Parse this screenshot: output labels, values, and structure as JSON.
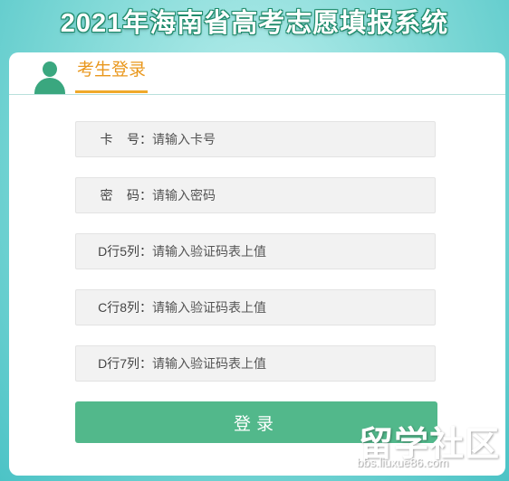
{
  "header": {
    "title": "2021年海南省高考志愿填报系统"
  },
  "login_tab": {
    "label": "考生登录"
  },
  "form": {
    "fields": [
      {
        "label": "卡    号：",
        "placeholder": "请输入卡号"
      },
      {
        "label": "密    码：",
        "placeholder": "请输入密码"
      },
      {
        "label": "D行5列：",
        "placeholder": "请输入验证码表上值"
      },
      {
        "label": "C行8列：",
        "placeholder": "请输入验证码表上值"
      },
      {
        "label": "D行7列：",
        "placeholder": "请输入验证码表上值"
      }
    ],
    "submit_label": "登录"
  },
  "watermark": {
    "text": "留学社区",
    "url": "bbs.liuxue86.com"
  },
  "colors": {
    "accent_green": "#52b88b",
    "tab_orange": "#e9971c",
    "title_outline": "#1d8a6a"
  }
}
